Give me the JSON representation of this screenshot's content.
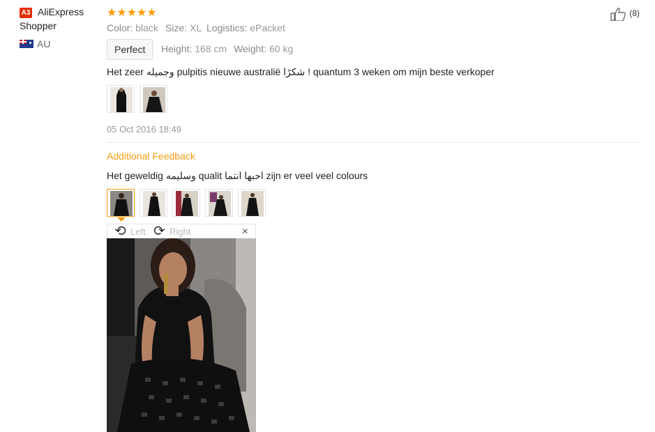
{
  "user": {
    "level_badge": "A3",
    "name_line1": "AliExpress",
    "name_line2": "Shopper",
    "country": "AU"
  },
  "rating": {
    "stars": 5,
    "glyphs": "★★★★★"
  },
  "attributes": [
    {
      "label": "Color:",
      "value": "black"
    },
    {
      "label": "Size:",
      "value": "XL"
    },
    {
      "label": "Logistics:",
      "value": "ePacket"
    }
  ],
  "fit": {
    "tag": "Perfect",
    "height_label": "Height:",
    "height_value": "168 cm",
    "weight_label": "Weight:",
    "weight_value": "60 kg"
  },
  "feedback_text": "Het zeer وجميله pulpitis nieuwe australië شكرًا ! quantum 3 weken om mijn beste verkoper",
  "date": "05 Oct 2016 18:49",
  "additional": {
    "title": "Additional Feedback",
    "text": "Het geweldig وسليمه qualit احبها انتما zijn er veel veel colours"
  },
  "viewer": {
    "left_label": "Left",
    "right_label": "Right",
    "rotate_left_glyph": "⟲",
    "rotate_right_glyph": "⟳",
    "close_glyph": "×"
  },
  "helpful": {
    "count": "(8)"
  },
  "colors": {
    "accent": "#f39c12",
    "star": "#ff9a00",
    "badge": "#e62e04"
  }
}
